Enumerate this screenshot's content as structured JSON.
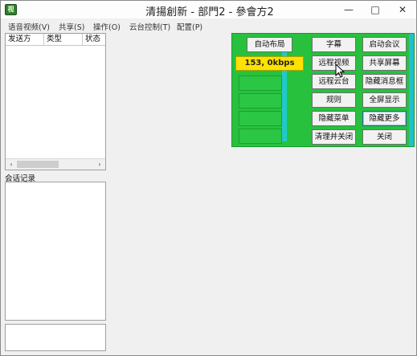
{
  "window": {
    "title": "清揚創新 - 部門2 - 參會方2",
    "app_icon": "视",
    "min_glyph": "—",
    "max_glyph": "□",
    "close_glyph": "✕"
  },
  "menubar": {
    "items": [
      "语音视频(V)",
      "共享(S)",
      "操作(O)",
      "云台控制(T)",
      "配置(P)"
    ]
  },
  "participants_table": {
    "columns": [
      "发送方",
      "类型",
      "状态"
    ]
  },
  "hscroll": {
    "left_glyph": "‹",
    "right_glyph": "›"
  },
  "chat_log": {
    "label": "会话记录"
  },
  "control_panel": {
    "auto_layout": "自动布局",
    "bandwidth": "153, 0kbps",
    "buttons": {
      "subtitle": "字幕",
      "start_meeting": "启动会议",
      "remote_video": "远程视频",
      "share_screen": "共享屏幕",
      "remote_ptz": "远程云台",
      "hide_message_box": "隐藏消息框",
      "rules": "规则",
      "fullscreen": "全屏显示",
      "hide_menu": "隐藏菜单",
      "hide_more": "隐藏更多",
      "clear_and_close": "清理并关闭",
      "close": "关闭"
    }
  }
}
